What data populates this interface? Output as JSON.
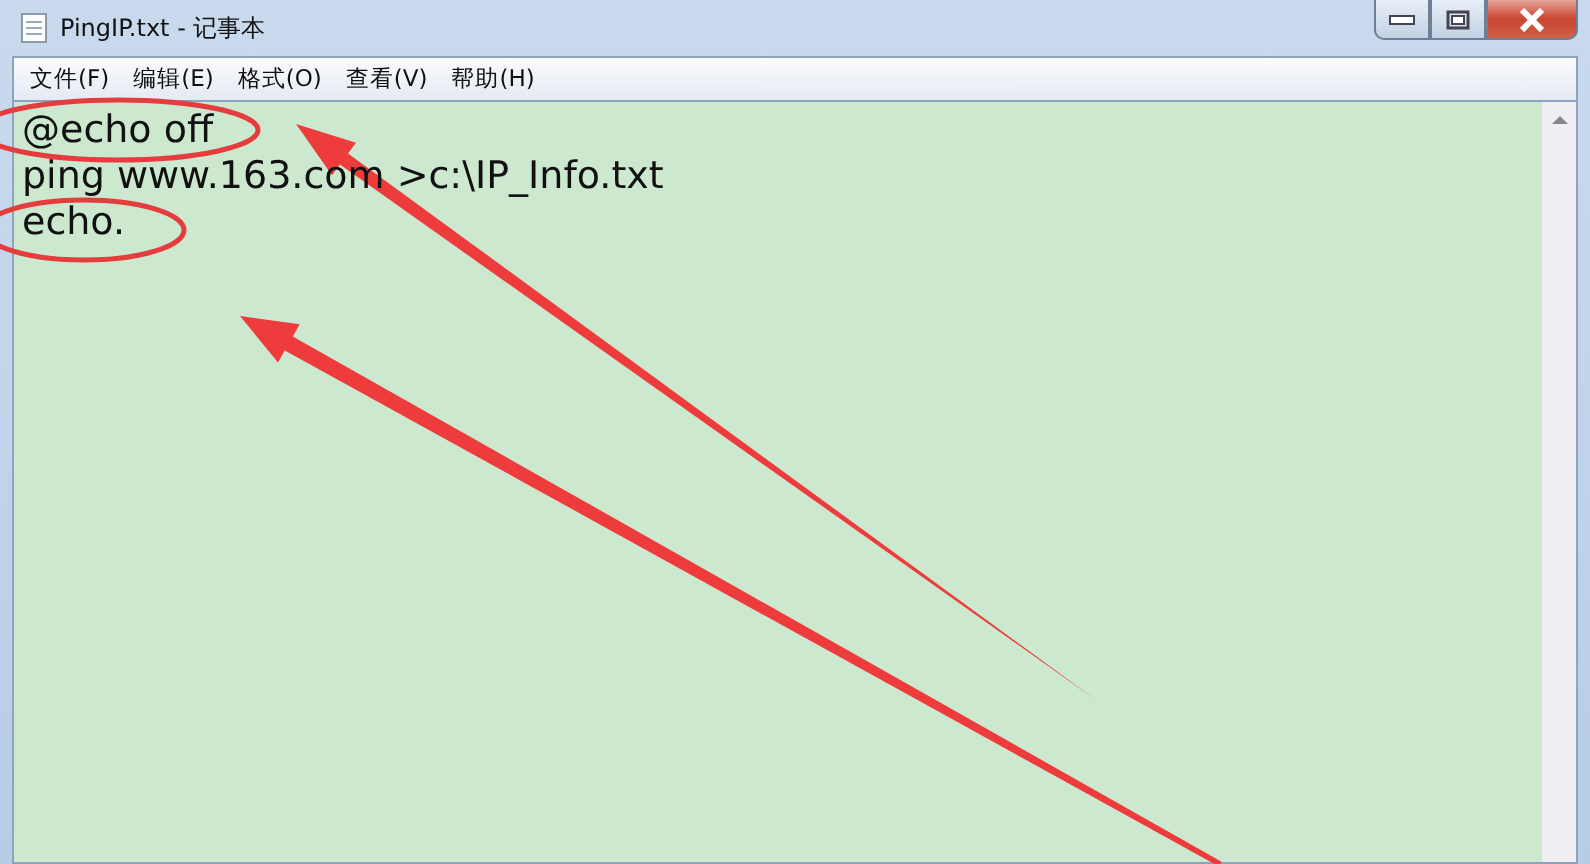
{
  "window": {
    "title": "PingIP.txt - 记事本"
  },
  "menu": [
    "文件(F)",
    "编辑(E)",
    "格式(O)",
    "查看(V)",
    "帮助(H)"
  ],
  "editor": {
    "lines": [
      "@echo off",
      "ping www.163.com >c:\\IP_Info.txt",
      "echo."
    ]
  }
}
